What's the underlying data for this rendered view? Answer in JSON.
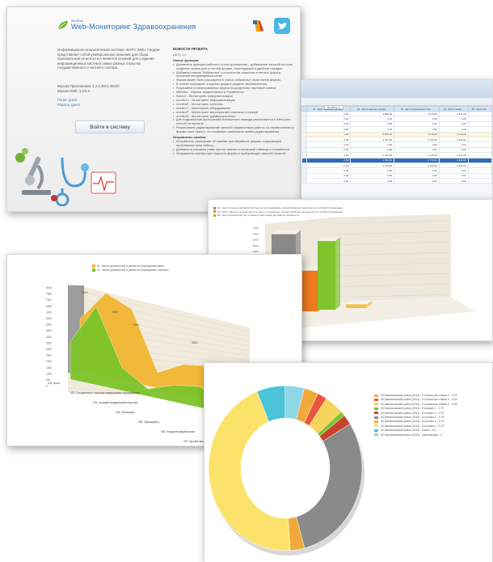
{
  "login": {
    "brand_small": "MedStat",
    "brand_name": "Web-Мониторинг Здравоохранения",
    "intro": "Информационно-аналитическая система «БАРС.Web» Сводом представляет собой универсальное решение для сбора произвольной отчетности и является основой для создания информационных систем в самых разных отраслях государственного и частного сектора.",
    "version_app": "Версия Приложения: 2.2.2.2013.39240",
    "version_web": "Версия Web: 1.0.6.0",
    "login_line": "Логин: guest",
    "password_line": "Пароль: guest",
    "login_button": "Войти в систему",
    "news_title": "НОВОСТИ ПРОЕКТА",
    "news_date": "ДАТА 0.0",
    "new_functions_title": "Новые функции:",
    "new_functions": [
      "Добавлена функция рабочего стола приложения - добавление записей на поле, создание записи для отчетной формы, переходящей в удобном порядке.",
      "Добавлен список \"Избранное\" к плоскостям открытия отчетных форм в основной настраиваемой сетке.",
      "Форма может быть расширена в список избранных через меню формы.",
      "В списке последних открытых форм в разделе автоматически.",
      "Разрешена сгенерированная форма посредством стартовой записи:",
      "effective - Оценка эффективности Управления",
      "finance - Мониторинг информатизации",
      "monitorU - Мониторинг информатизации",
      "monitorE - Мониторинг качества",
      "monitorT - Мониторинг оборудования",
      "monitorP - Мониторинг мероприятий плановых и резерв",
      "monitorS - Мониторинг здравоохранения",
      "Для подключения приложений возможность вывода разъясняется в Web-узел, способ на портале.",
      "Реализована редактирование записей справочников работы со справочником (с формы окон нужно), что позволяет уменьшить время редактирования."
    ],
    "fixed_title": "Исправлены ошибки:",
    "fixed": [
      "Исправлено сообщение об ошибке при обработке формы, содержащей проблемные окна таблиц.",
      "Добавлена ускорена рамы при на знании статической таблицы и сохранении.",
      "Исправлена ошибка при открытии формы и выбирающих записей записей."
    ]
  },
  "social": {
    "lab_caption": "Web Lab",
    "twitter_icon": "twitter-icon"
  },
  "grid": {
    "toolbar_button": "Колбец: 1",
    "columns": [
      "",
      "01. Число штатных должн...",
      "02. Число занятых должн...",
      "03. Число физических лиц...",
      "04. Число вакан...",
      "05. Число ва..."
    ],
    "rows": [
      {
        "label": "",
        "cells": [
          "0.00",
          "4 800,00",
          "4 175,00",
          "4 611,00",
          ""
        ]
      },
      {
        "label": "",
        "cells": [
          "0.00",
          "0.00",
          "0.00",
          "0.00",
          ""
        ]
      },
      {
        "label": "",
        "cells": [
          "0.00",
          "0.00",
          "0.00",
          "0.00",
          ""
        ]
      },
      {
        "label": "",
        "cells": [
          "0.00",
          "0.00",
          "0.00",
          "0.00",
          ""
        ]
      },
      {
        "label": "",
        "cells": [
          "1.00",
          "4 800,00",
          "4 175,00",
          "4 611,00",
          ""
        ],
        "style": "ylw"
      },
      {
        "label": "",
        "cells": [
          "0.00",
          "4 310,00",
          "2 705,00",
          "4 296,00",
          ""
        ]
      },
      {
        "label": "",
        "cells": [
          "0.00",
          "0.00",
          "0.00",
          "0.00",
          ""
        ]
      },
      {
        "label": "",
        "cells": [
          "0.00",
          "0.00",
          "0.00",
          "0.00",
          ""
        ]
      },
      {
        "label": "",
        "cells": [
          "0.00",
          "4 310,00",
          "4 175,00",
          "4 611,00",
          ""
        ]
      },
      {
        "label": "",
        "cells": [
          "2.00",
          "1 090,00",
          "1 173,00",
          "4 296,00",
          ""
        ],
        "style": "sel"
      },
      {
        "label": "",
        "cells": [
          "0.00",
          "2 770,00",
          "2 100,00",
          "3 811,00",
          ""
        ]
      },
      {
        "label": "",
        "cells": [
          "0.00",
          "0.00",
          "0.00",
          "0.00",
          ""
        ]
      },
      {
        "label": "",
        "cells": [
          "0.00",
          "0.00",
          "0.00",
          "0.00",
          ""
        ]
      },
      {
        "label": "",
        "cells": [
          "0.00",
          "0.00",
          "0.00",
          "0.00",
          ""
        ]
      }
    ]
  },
  "bar_chart": {
    "legend": [
      "01. Число штатных должностей в целом по учреждению, осуществляющих деятельность в областях медицины",
      "02. Число занятых должностей в целом по учреждению, осуществляющих деятельность в областях медицины",
      "03. Число физических лиц основных работников на занятых должностях",
      "04. Число вакантных должностей в целом по учреждению"
    ],
    "y_ticks": [
      "7000",
      "6500",
      "6000",
      "5500",
      "5000",
      "4500",
      "4000",
      "3500",
      "3000",
      "2500",
      "2000",
      "1500",
      "1000",
      "500",
      "0"
    ]
  },
  "chart_data": [
    {
      "type": "bar",
      "title": "",
      "categories": [
        "01",
        "02",
        "03",
        "04"
      ],
      "values": [
        6200,
        3200,
        5400,
        300
      ],
      "ylim": [
        0,
        7000
      ],
      "colors": [
        "#8a8a8a",
        "#f07a1e",
        "#7ec42a",
        "#f2c14b"
      ]
    },
    {
      "type": "area",
      "title": "",
      "categories": [
        "001. Всего",
        "002. Специалисты с высшим медицинским образованием",
        "003. Средний медицинский персонал",
        "004. Провизоры",
        "005. Фармацевты",
        "006. Младший медперсонал",
        "007. Прочий персонал"
      ],
      "series": [
        {
          "name": "01. Число должностей в целом по учреждению всего",
          "values": [
            5000,
            8000,
            7000,
            1500,
            2800,
            3200,
            3600
          ],
          "color": "#f2b632"
        },
        {
          "name": "02. Число должностей в целом по учреждению, занятые",
          "values": [
            3600,
            7500,
            2200,
            700,
            1600,
            2000,
            1200
          ],
          "color": "#7ec42a"
        }
      ],
      "ylim": [
        0,
        8500
      ]
    },
    {
      "type": "pie",
      "title": "",
      "labels": [
        "30 Механический район (2011) - 3 полностью ставок 2 - 0,29",
        "30 Механический район (2011) - 3 полностью ставок 2 - 0,29",
        "30 Механический район (2011) - 3 полностью ставок 2 - 0,29",
        "30 Механический район (2011) - 8 полных 1 - 0,79",
        "30 Механический район (2011) - 8 полных 1 - 0,79",
        "30 Механический район (2012) - 8 полных 1 - 0,79",
        "30 Механический район (2012) - 8 полных 1 - 0,79",
        "30 Механический район (2012) - 8 полных 1 - 0,79",
        "30 Механический район (2012) - Всего - 0,0",
        "30 Механический район (2013) - работающих - 0"
      ],
      "values": [
        3,
        2,
        4,
        1,
        2,
        30,
        3,
        45,
        6,
        4
      ],
      "colors": [
        "#f2a93b",
        "#e8583b",
        "#f6d35a",
        "#7ec42a",
        "#c7432e",
        "#8a8a8a",
        "#f2a93b",
        "#fbe36b",
        "#4cc4d8",
        "#8fd7e7"
      ]
    }
  ],
  "area_legend": [
    "01. Число должностей в целом по учреждению всего",
    "02. Число должностей в целом по учреждению, занятые"
  ],
  "area_axis": {
    "y_ticks": [
      "8000",
      "7500",
      "7000",
      "6500",
      "6000",
      "5500",
      "5000",
      "4500",
      "4000",
      "3500",
      "3000",
      "2500",
      "2000",
      "1500",
      "1000",
      "500",
      "0"
    ],
    "peak_labels": [
      "5000",
      "8000",
      "7000",
      "3600"
    ]
  },
  "donut_legend_title": "30 Механический район (2011)"
}
